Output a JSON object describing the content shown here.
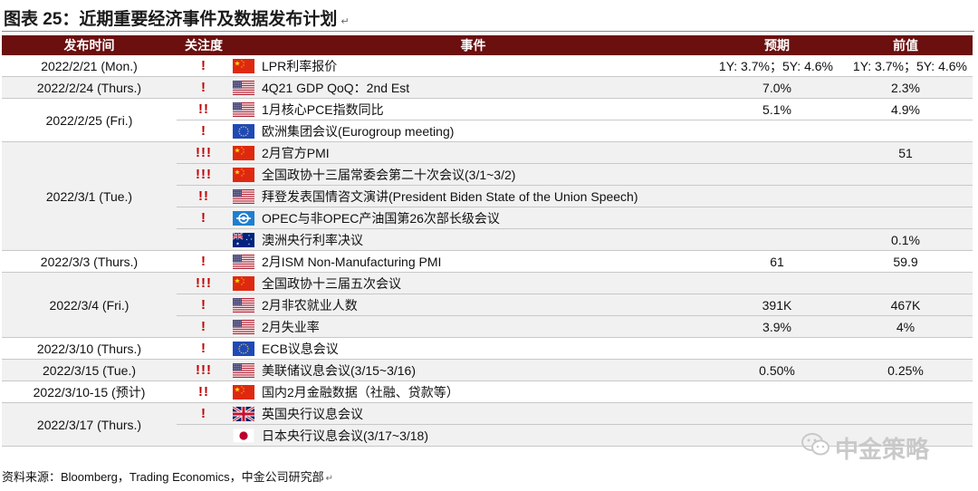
{
  "title": "图表 25：近期重要经济事件及数据发布计划",
  "title_mark": "↵",
  "headers": [
    "发布时间",
    "关注度",
    "事件",
    "预期",
    "前值"
  ],
  "rows": [
    {
      "date": "2022/2/21 (Mon.)",
      "attention": "!",
      "flag": "china-flag",
      "event": "LPR利率报价",
      "expected": "1Y: 3.7%；5Y: 4.6%",
      "previous": "1Y: 3.7%；5Y: 4.6%"
    },
    {
      "date": "2022/2/24 (Thurs.)",
      "attention": "!",
      "flag": "us-flag",
      "event": "4Q21 GDP QoQ：2nd Est",
      "expected": "7.0%",
      "previous": "2.3%"
    },
    {
      "date": "2022/2/25 (Fri.)",
      "attention": "!!",
      "flag": "us-flag",
      "event": "1月核心PCE指数同比",
      "expected": "5.1%",
      "previous": "4.9%"
    },
    {
      "date": "",
      "attention": "!",
      "flag": "eu-flag",
      "event": "欧洲集团会议(Eurogroup meeting)",
      "expected": "",
      "previous": ""
    },
    {
      "date": "2022/3/1 (Tue.)",
      "attention": "!!!",
      "flag": "china-flag",
      "event": "2月官方PMI",
      "expected": "",
      "previous": "51"
    },
    {
      "date": "",
      "attention": "!!!",
      "flag": "china-flag",
      "event": "全国政协十三届常委会第二十次会议(3/1~3/2)",
      "expected": "",
      "previous": ""
    },
    {
      "date": "",
      "attention": "!!",
      "flag": "us-flag",
      "event": "拜登发表国情咨文演讲(President Biden State of the Union Speech)",
      "expected": "",
      "previous": ""
    },
    {
      "date": "",
      "attention": "!",
      "flag": "opec-flag",
      "event": "OPEC与非OPEC产油国第26次部长级会议",
      "expected": "",
      "previous": ""
    },
    {
      "date": "",
      "attention": "",
      "flag": "australia-flag",
      "event": "澳洲央行利率决议",
      "expected": "",
      "previous": "0.1%"
    },
    {
      "date": "2022/3/3 (Thurs.)",
      "attention": "!",
      "flag": "us-flag",
      "event": "2月ISM Non-Manufacturing PMI",
      "expected": "61",
      "previous": "59.9"
    },
    {
      "date": "2022/3/4 (Fri.)",
      "attention": "!!!",
      "flag": "china-flag",
      "event": "全国政协十三届五次会议",
      "expected": "",
      "previous": ""
    },
    {
      "date": "",
      "attention": "!",
      "flag": "us-flag",
      "event": "2月非农就业人数",
      "expected": "391K",
      "previous": "467K"
    },
    {
      "date": "",
      "attention": "!",
      "flag": "us-flag",
      "event": "2月失业率",
      "expected": "3.9%",
      "previous": "4%"
    },
    {
      "date": "2022/3/10 (Thurs.)",
      "attention": "!",
      "flag": "eu-flag",
      "event": "ECB议息会议",
      "expected": "",
      "previous": ""
    },
    {
      "date": "2022/3/15 (Tue.)",
      "attention": "!!!",
      "flag": "us-flag",
      "event": "美联储议息会议(3/15~3/16)",
      "expected": "0.50%",
      "previous": "0.25%"
    },
    {
      "date": "2022/3/10-15 (预计)",
      "attention": "!!",
      "flag": "china-flag",
      "event": "国内2月金融数据（社融、贷款等）",
      "expected": "",
      "previous": ""
    },
    {
      "date": "2022/3/17 (Thurs.)",
      "attention": "!",
      "flag": "uk-flag",
      "event": "英国央行议息会议",
      "expected": "",
      "previous": ""
    },
    {
      "date": "",
      "attention": "",
      "flag": "japan-flag",
      "event": "日本央行议息会议(3/17~3/18)",
      "expected": "",
      "previous": ""
    }
  ],
  "source": "资料来源：Bloomberg，Trading Economics，中金公司研究部",
  "source_mark": "↵",
  "watermark": "中金策略",
  "colors": {
    "header_bg": "#6b0f0f",
    "attention": "#c00000",
    "shade": "#f1f1f1"
  }
}
